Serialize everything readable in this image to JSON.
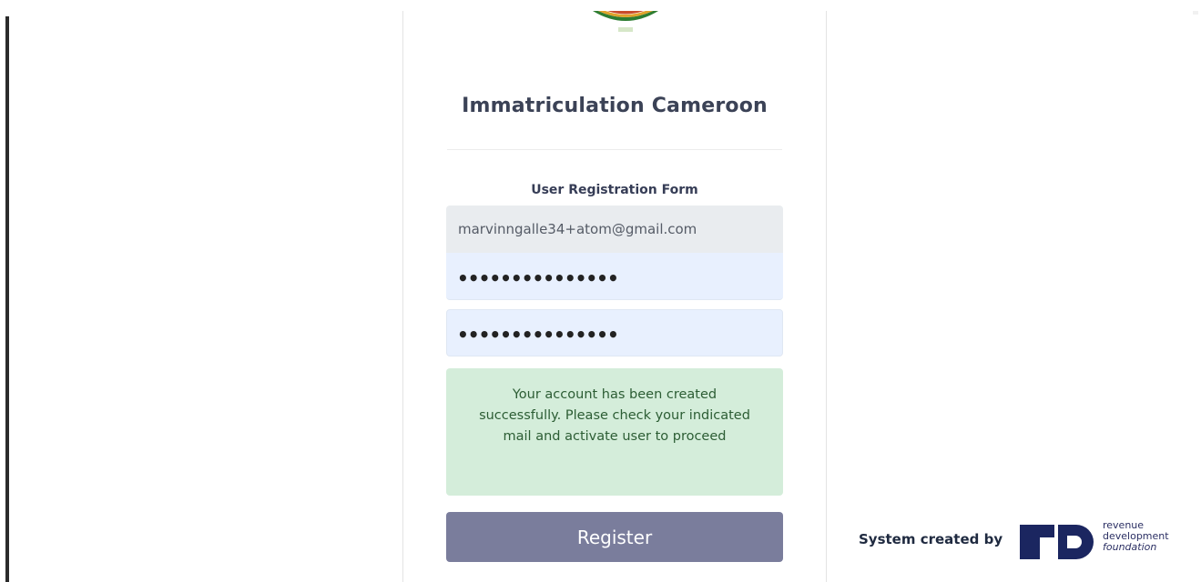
{
  "form": {
    "title": "Immatriculation Cameroon",
    "subtitle": "User Registration Form",
    "email_value": "marvinngalle34+atom@gmail.com",
    "password_mask": "•••••••••••••••",
    "confirm_password_mask": "•••••••••••••••",
    "success_message": "Your account has been created successfully. Please check your indicated mail and activate user to proceed",
    "register_label": "Register"
  },
  "footer": {
    "credit_label": "System created by",
    "brand_line1": "revenue",
    "brand_line2": "development",
    "brand_line3": "foundation"
  },
  "colors": {
    "title": "#3b4256",
    "success_bg": "#d4edda",
    "success_text": "#2c5d34",
    "register_bg": "#7a7d9c",
    "autofill_bg": "#e8f0fe",
    "brand_navy": "#1b2660"
  },
  "icons": {
    "logo": "coat-of-arms-logo",
    "rd": "rdf-logo"
  }
}
